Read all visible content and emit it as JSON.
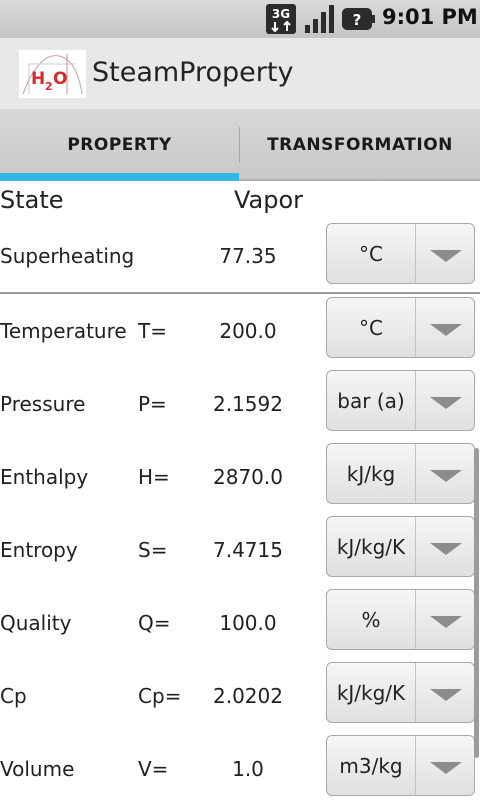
{
  "status_bar": {
    "network": "3G",
    "time": "9:01 PM",
    "icons": [
      "3g-data-icon",
      "signal-icon",
      "battery-unknown-icon"
    ]
  },
  "title_bar": {
    "logo_text": "H2O",
    "title": "SteamProperty"
  },
  "tabs": [
    {
      "label": "PROPERTY",
      "selected": true
    },
    {
      "label": "TRANSFORMATION",
      "selected": false
    }
  ],
  "state": {
    "label": "State",
    "value": "Vapor"
  },
  "superheating": {
    "label": "Superheating",
    "value": "77.35",
    "unit": "°C"
  },
  "properties": [
    {
      "label": "Temperature",
      "symbol": "T=",
      "value": "200.0",
      "unit": "°C"
    },
    {
      "label": "Pressure",
      "symbol": "P=",
      "value": "2.1592",
      "unit": "bar (a)"
    },
    {
      "label": "Enthalpy",
      "symbol": "H=",
      "value": "2870.0",
      "unit": "kJ/kg"
    },
    {
      "label": "Entropy",
      "symbol": "S=",
      "value": "7.4715",
      "unit": "kJ/kg/K"
    },
    {
      "label": "Quality",
      "symbol": "Q=",
      "value": "100.0",
      "unit": "%"
    },
    {
      "label": "Cp",
      "symbol": "Cp=",
      "value": "2.0202",
      "unit": "kJ/kg/K"
    },
    {
      "label": "Volume",
      "symbol": "V=",
      "value": "1.0",
      "unit": "m3/kg"
    }
  ],
  "colors": {
    "accent": "#33b5e5",
    "logo_red": "#d82b2b"
  }
}
